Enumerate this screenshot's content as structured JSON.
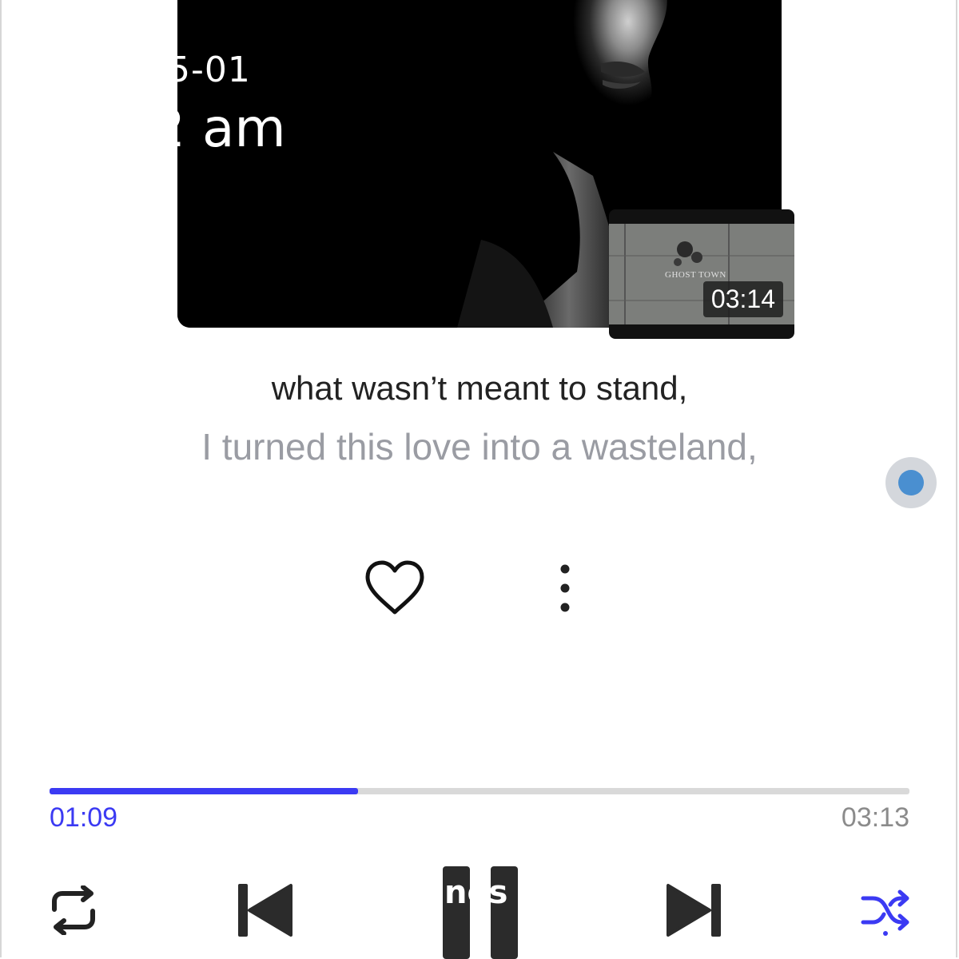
{
  "overlay": {
    "date_text": "5-01",
    "time_text": "2 am"
  },
  "album": {
    "art_icon": "portrait-image"
  },
  "video": {
    "thumbnail_caption": "GHOST TOWN",
    "duration": "03:14"
  },
  "lyrics": {
    "current_line": "what wasn’t meant to stand,",
    "next_line": "I turned this love into a wasteland,"
  },
  "actions": {
    "like_icon": "heart-outline-icon",
    "more_icon": "vertical-ellipsis-icon"
  },
  "playback": {
    "elapsed": "01:09",
    "total": "03:13",
    "progress_fraction": 0.359
  },
  "controls": {
    "repeat_icon": "repeat-icon",
    "previous_icon": "skip-previous-icon",
    "play_pause_icon": "pause-icon",
    "pause_overlay_text": "nes",
    "next_icon": "skip-next-icon",
    "shuffle_icon": "shuffle-icon"
  },
  "colors": {
    "accent": "#3b3af3",
    "track": "#d9d9d9",
    "lyric_current": "#222222",
    "lyric_next": "#9a9ca3",
    "assistive_dot": "#4a8fd0"
  }
}
